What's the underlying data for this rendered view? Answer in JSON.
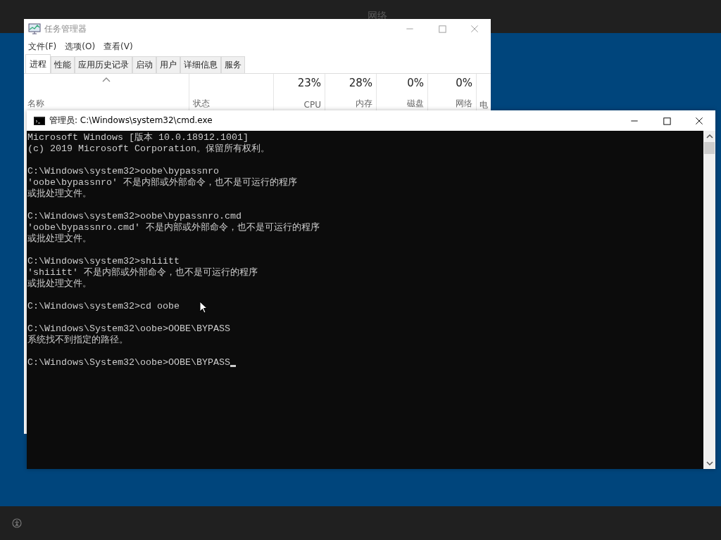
{
  "top_bar": {
    "title": "网络"
  },
  "task_manager": {
    "title": "任务管理器",
    "menu": [
      "文件(F)",
      "选项(O)",
      "查看(V)"
    ],
    "tabs": [
      {
        "label": "进程",
        "selected": true
      },
      {
        "label": "性能",
        "selected": false
      },
      {
        "label": "应用历史记录",
        "selected": false
      },
      {
        "label": "启动",
        "selected": false
      },
      {
        "label": "用户",
        "selected": false
      },
      {
        "label": "详细信息",
        "selected": false
      },
      {
        "label": "服务",
        "selected": false
      }
    ],
    "columns": [
      {
        "label": "名称",
        "sorted": true
      },
      {
        "label": "状态",
        "sorted": false
      },
      {
        "label": "CPU",
        "usage": "23%",
        "sorted": false
      },
      {
        "label": "内存",
        "usage": "28%",
        "sorted": false
      },
      {
        "label": "磁盘",
        "usage": "0%",
        "sorted": false
      },
      {
        "label": "网络",
        "usage": "0%",
        "sorted": false
      },
      {
        "label": "电",
        "sorted": false
      }
    ]
  },
  "cmd": {
    "title": "管理员: C:\\Windows\\system32\\cmd.exe",
    "cursor": true,
    "blocks": [
      {
        "lines": [
          "Microsoft Windows [版本 10.0.18912.1001]",
          "(c) 2019 Microsoft Corporation。保留所有权利。"
        ]
      },
      {
        "lines": [
          "C:\\Windows\\system32>oobe\\bypassnro",
          "'oobe\\bypassnro' 不是内部或外部命令，也不是可运行的程序",
          "或批处理文件。"
        ]
      },
      {
        "lines": [
          "C:\\Windows\\system32>oobe\\bypassnro.cmd",
          "'oobe\\bypassnro.cmd' 不是内部或外部命令，也不是可运行的程序",
          "或批处理文件。"
        ]
      },
      {
        "lines": [
          "C:\\Windows\\system32>shiiitt",
          "'shiiitt' 不是内部或外部命令，也不是可运行的程序",
          "或批处理文件。"
        ]
      },
      {
        "lines": [
          "C:\\Windows\\system32>cd oobe"
        ]
      },
      {
        "lines": [
          "C:\\Windows\\System32\\oobe>OOBE\\BYPASS",
          "系统找不到指定的路径。"
        ]
      },
      {
        "lines": [
          "C:\\Windows\\System32\\oobe>OOBE\\BYPASS"
        ]
      }
    ]
  }
}
